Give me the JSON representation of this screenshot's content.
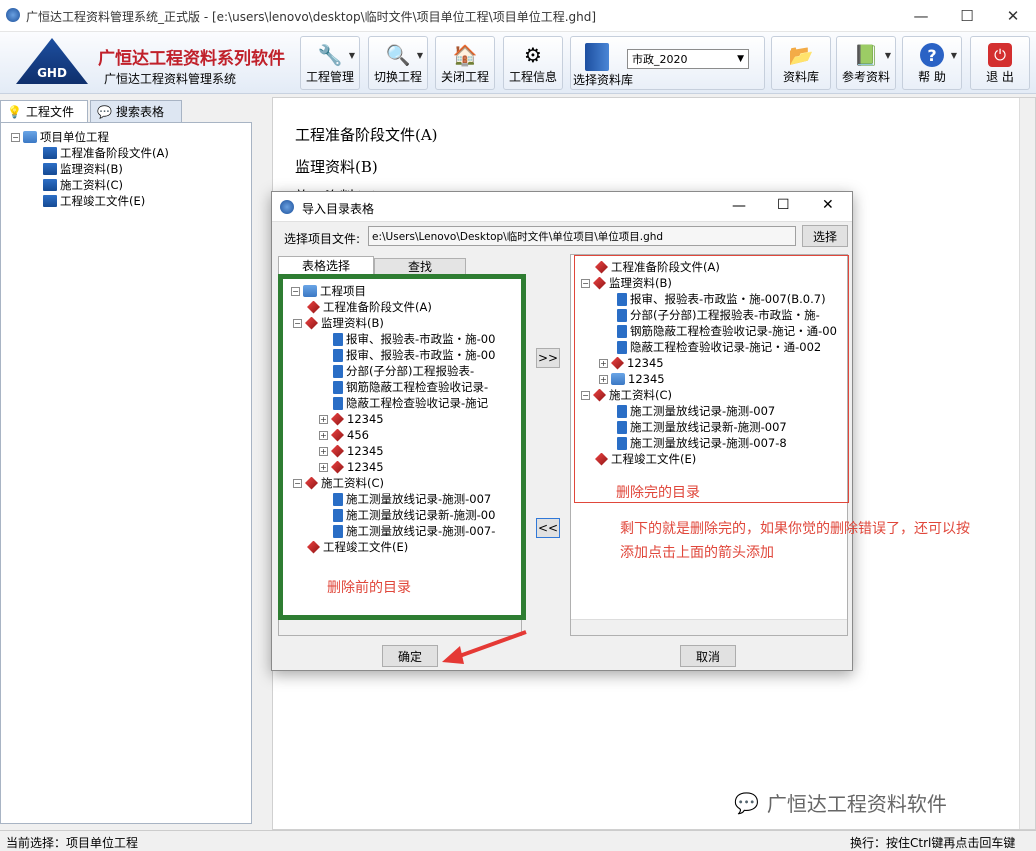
{
  "window": {
    "title": "广恒达工程资料管理系统_正式版 - [e:\\users\\lenovo\\desktop\\临时文件\\项目单位工程\\项目单位工程.ghd]"
  },
  "brand": {
    "logo_text": "GHD",
    "name": "广恒达工程资料系列软件",
    "subtitle": "广恒达工程资料管理系统"
  },
  "toolbar": {
    "project_mgmt": "工程管理",
    "switch_project": "切换工程",
    "close_project": "关闭工程",
    "project_info": "工程信息",
    "select_library": "选择资料库",
    "library_select_value": "市政_2020",
    "library": "资料库",
    "reference": "参考资料",
    "help": "帮 助",
    "exit": "退 出"
  },
  "left_tabs": {
    "project_files": "工程文件",
    "search_tables": "搜索表格"
  },
  "left_tree": {
    "root": "项目单位工程",
    "items": [
      "工程准备阶段文件(A)",
      "监理资料(B)",
      "施工资料(C)",
      "工程竣工文件(E)"
    ]
  },
  "main_content": {
    "items": [
      "工程准备阶段文件(A)",
      "监理资料(B)",
      "施工资料(C)"
    ]
  },
  "dialog": {
    "title": "导入目录表格",
    "file_label": "选择项目文件:",
    "file_path": "e:\\Users\\Lenovo\\Desktop\\临时文件\\单位项目\\单位项目.ghd",
    "browse_button": "选择",
    "tab_select": "表格选择",
    "tab_find": "查找",
    "add_button": ">>",
    "remove_button": "<<",
    "ok_button": "确定",
    "cancel_button": "取消",
    "left_tree": {
      "root": "工程项目",
      "a": "工程准备阶段文件(A)",
      "b": "监理资料(B)",
      "b_docs": [
        "报审、报验表-市政监・施-00",
        "报审、报验表-市政监・施-00",
        "分部(子分部)工程报验表-",
        "钢筋隐蔽工程检查验收记录-",
        "隐蔽工程检查验收记录-施记"
      ],
      "b_groups": [
        "12345",
        "456",
        "12345",
        "12345"
      ],
      "c": "施工资料(C)",
      "c_docs": [
        "施工测量放线记录-施测-007",
        "施工测量放线记录新-施测-00",
        "施工测量放线记录-施测-007-"
      ],
      "e": "工程竣工文件(E)"
    },
    "right_tree": {
      "a": "工程准备阶段文件(A)",
      "b": "监理资料(B)",
      "b_docs": [
        "报审、报验表-市政监・施-007(B.0.7)",
        "分部(子分部)工程报验表-市政监・施-",
        "钢筋隐蔽工程检查验收记录-施记・通-00",
        "隐蔽工程检查验收记录-施记・通-002"
      ],
      "b_groups": [
        "12345",
        "12345"
      ],
      "c": "施工资料(C)",
      "c_docs": [
        "施工测量放线记录-施测-007",
        "施工测量放线记录新-施测-007",
        "施工测量放线记录-施测-007-8"
      ],
      "e": "工程竣工文件(E)"
    }
  },
  "annotations": {
    "before": "删除前的目录",
    "after": "删除完的目录",
    "note_line1": "剩下的就是删除完的，如果你觉的删除错误了，还可以按",
    "note_line2": "添加点击上面的箭头添加"
  },
  "watermark": "广恒达工程资料软件",
  "statusbar": {
    "left": "当前选择：项目单位工程",
    "right": "换行：按住Ctrl键再点击回车键"
  },
  "colors": {
    "highlight_green": "#2e7d32",
    "annotation_red": "#e0473b",
    "arrow_red": "#e53935"
  }
}
